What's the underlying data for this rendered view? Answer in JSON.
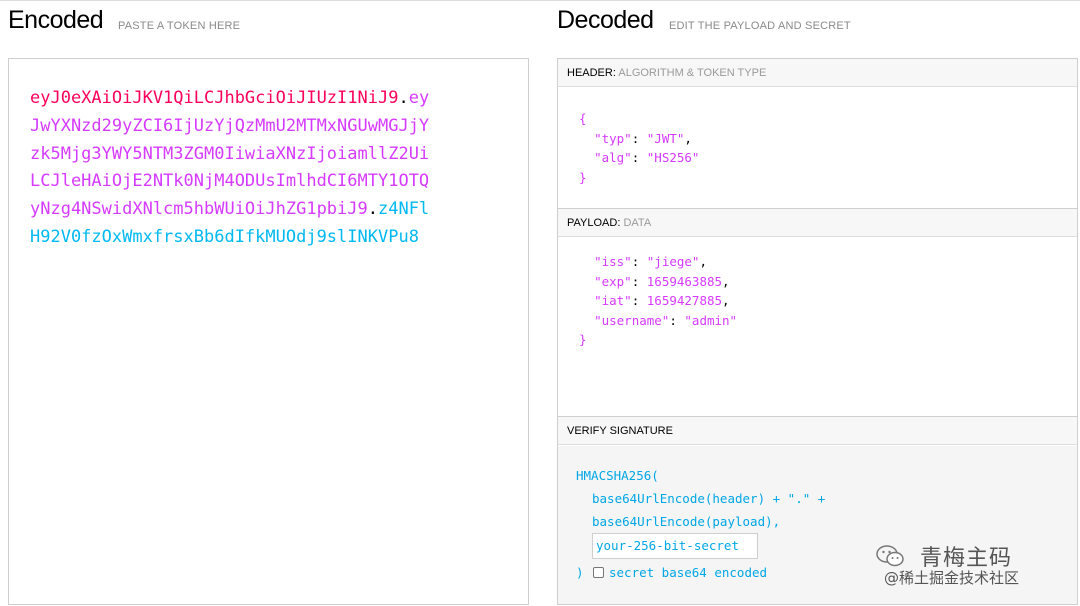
{
  "encoded": {
    "title": "Encoded",
    "subtitle": "PASTE A TOKEN HERE",
    "token_lines": [
      [
        {
          "t": "h",
          "text": "eyJ0eXAiOiJKV1QiLCJhbGciOiJIUzI1NiJ9"
        },
        {
          "t": "d",
          "text": "."
        },
        {
          "t": "p",
          "text": "ey"
        }
      ],
      [
        {
          "t": "p",
          "text": "JwYXNzd29yZCI6IjUzYjQzMmU2MTMxNGUwMGJjY"
        }
      ],
      [
        {
          "t": "p",
          "text": "zk5Mjg3YWY5NTM3ZGM0IiwiaXNzIjoiamllZ2Ui"
        }
      ],
      [
        {
          "t": "p",
          "text": "LCJleHAiOjE2NTk0NjM4ODUsImlhdCI6MTY1OTQ"
        }
      ],
      [
        {
          "t": "p",
          "text": "yNzg4NSwidXNlcm5hbWUiOiJhZG1pbiJ9"
        },
        {
          "t": "d",
          "text": "."
        },
        {
          "t": "s",
          "text": "z4NFl"
        }
      ],
      [
        {
          "t": "s",
          "text": "H92V0fzOxWmxfrsxBb6dIfkMUOdj9slINKVPu8"
        }
      ]
    ]
  },
  "decoded": {
    "title": "Decoded",
    "subtitle": "EDIT THE PAYLOAD AND SECRET",
    "header_section": {
      "label": "HEADER:",
      "sublabel": "ALGORITHM & TOKEN TYPE",
      "open": "{",
      "typ_key": "\"typ\"",
      "typ_val": "\"JWT\"",
      "alg_key": "\"alg\"",
      "alg_val": "\"HS256\"",
      "close": "}"
    },
    "payload_section": {
      "label": "PAYLOAD:",
      "sublabel": "DATA",
      "iss_key": "\"iss\"",
      "iss_val": "\"jiege\"",
      "exp_key": "\"exp\"",
      "exp_val": "1659463885",
      "iat_key": "\"iat\"",
      "iat_val": "1659427885",
      "username_key": "\"username\"",
      "username_val": "\"admin\"",
      "close": "}"
    },
    "signature_section": {
      "label": "VERIFY SIGNATURE",
      "line1": "HMACSHA256(",
      "line2": "base64UrlEncode(header) + \".\" +",
      "line3": "base64UrlEncode(payload),",
      "secret_placeholder": "your-256-bit-secret",
      "close_paren": ")",
      "checkbox_label": "secret base64 encoded"
    }
  },
  "watermark": {
    "title": "青梅主码",
    "subtitle": "@稀土掘金技术社区",
    "icon": "wechat-icon"
  },
  "colors": {
    "header": "#fb015b",
    "payload": "#d63aff",
    "signature": "#00b9f1"
  }
}
